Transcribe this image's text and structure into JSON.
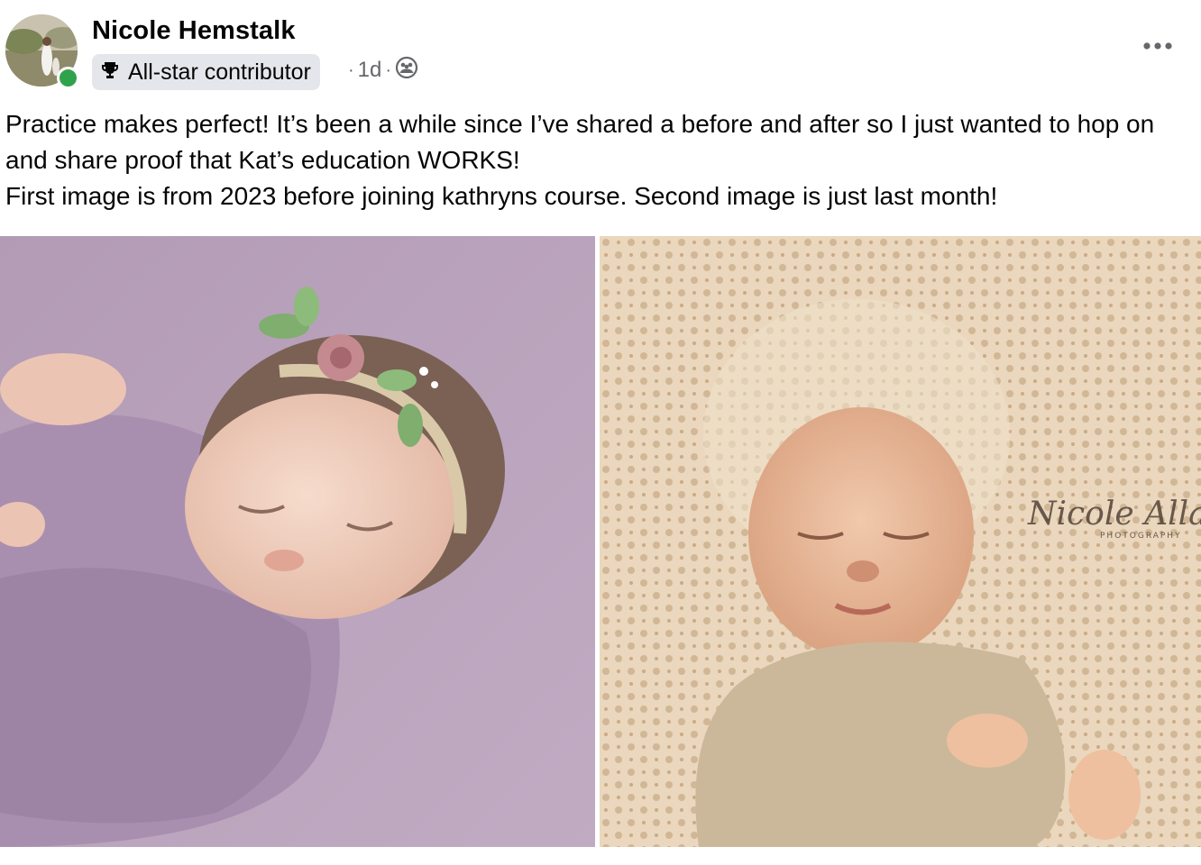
{
  "post": {
    "author_name": "Nicole Hemstalk",
    "badge_label": "All-star contributor",
    "timestamp": "1d",
    "separator": "·",
    "audience_icon": "group-icon",
    "more_icon": "more-options-icon",
    "body_lines": [
      "Practice makes perfect! It’s been a while since I’ve shared a before and after so I just wanted to hop on and share proof that Kat’s education WORKS!",
      "First image is from 2023 before joining kathryns course. Second image is just last month!"
    ],
    "photos": [
      {
        "name": "before-photo"
      },
      {
        "name": "after-photo",
        "watermark": "Nicole Allaire",
        "watermark_sub": "PHOTOGRAPHY"
      }
    ]
  },
  "colors": {
    "online": "#31a24c",
    "badge_bg": "#e4e6eb",
    "secondary_text": "#65676b"
  }
}
